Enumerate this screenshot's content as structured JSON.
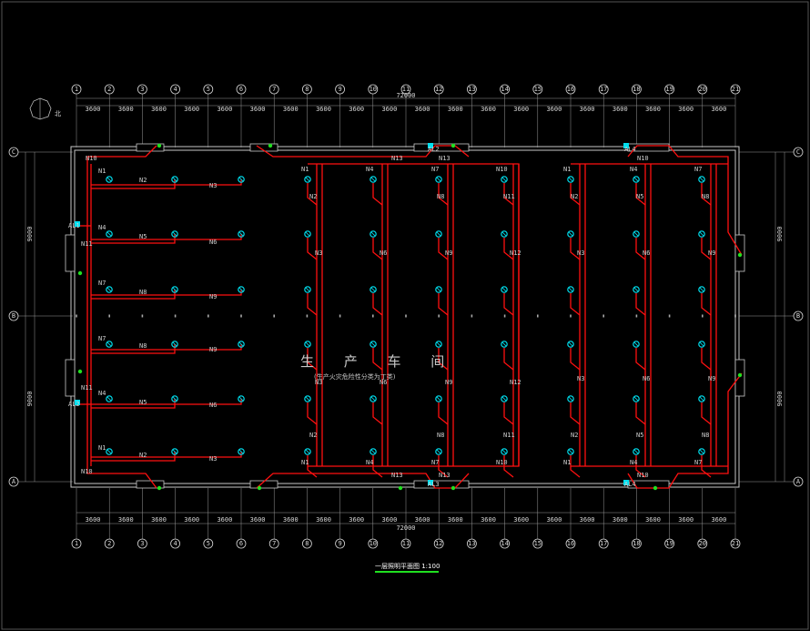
{
  "colors": {
    "background": "#000000",
    "linework": "#c8c8c8",
    "wiring": "#ff1010",
    "fixture": "#00e0f0",
    "exit_sign": "#20e020"
  },
  "drawing": {
    "title": "一层照明平面图 1:100",
    "room_title": "生 产 车 间",
    "room_note": "(生产火灾危险性分类为丁类)",
    "north_mark": "北"
  },
  "axes": {
    "columns": [
      "1",
      "2",
      "3",
      "4",
      "5",
      "6",
      "7",
      "8",
      "9",
      "10",
      "11",
      "12",
      "13",
      "14",
      "15",
      "16",
      "17",
      "18",
      "19",
      "20",
      "21"
    ],
    "rows": [
      "A",
      "B",
      "C"
    ],
    "top_overall_dim": "72000",
    "bottom_overall_dim": "72000",
    "bay_dim": "3600",
    "end_dim": "240",
    "row_dim": "9000"
  },
  "circuits": {
    "left": [
      "N1",
      "N2",
      "N3",
      "N4",
      "N5",
      "N6",
      "N7",
      "N8",
      "N9",
      "N10",
      "N11"
    ],
    "middle": [
      "N1",
      "N2",
      "N3",
      "N4",
      "N5",
      "N6",
      "N7",
      "N8",
      "N9",
      "N10",
      "N11",
      "N12",
      "N13"
    ],
    "right": [
      "N1",
      "N2",
      "N3",
      "N4",
      "N5",
      "N6",
      "N7",
      "N8",
      "N9",
      "N10"
    ],
    "panels": [
      "AL1",
      "AL2",
      "AL3",
      "AL4"
    ]
  }
}
